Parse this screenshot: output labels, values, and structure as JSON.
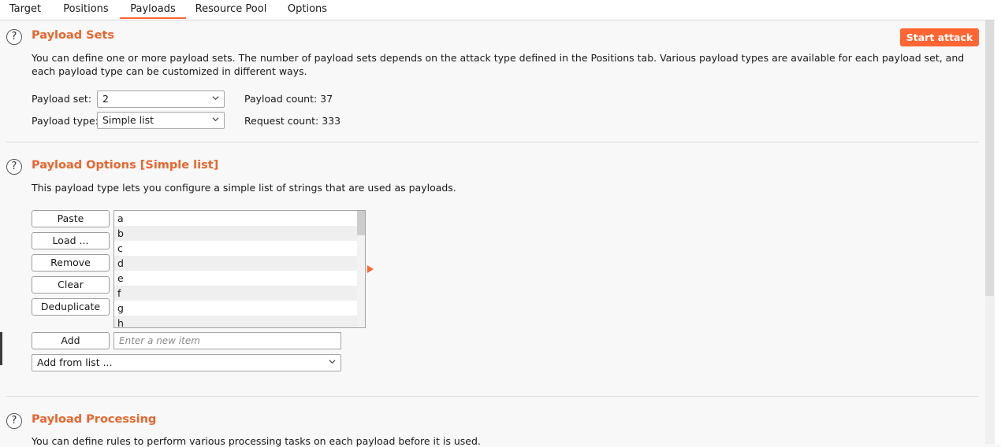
{
  "tabs": [
    {
      "label": "Target",
      "active": false
    },
    {
      "label": "Positions",
      "active": false
    },
    {
      "label": "Payloads",
      "active": true
    },
    {
      "label": "Resource Pool",
      "active": false
    },
    {
      "label": "Options",
      "active": false
    }
  ],
  "colors": {
    "accent": "#ff6633",
    "heading": "#e8662e"
  },
  "payload_sets": {
    "title": "Payload Sets",
    "start_attack": "Start attack",
    "description": "You can define one or more payload sets. The number of payload sets depends on the attack type defined in the Positions tab. Various payload types are available for each payload set, and each payload type can be customized in different ways.",
    "set_label": "Payload set:",
    "set_value": "2",
    "type_label": "Payload type:",
    "type_value": "Simple list",
    "payload_count": "Payload count: 37",
    "request_count": "Request count: 333"
  },
  "payload_options": {
    "title": "Payload Options [Simple list]",
    "description": "This payload type lets you configure a simple list of strings that are used as payloads.",
    "buttons": {
      "paste": "Paste",
      "load": "Load ...",
      "remove": "Remove",
      "clear": "Clear",
      "deduplicate": "Deduplicate",
      "add": "Add"
    },
    "items": [
      "a",
      "b",
      "c",
      "d",
      "e",
      "f",
      "g",
      "h"
    ],
    "new_item_placeholder": "Enter a new item",
    "add_from_list": "Add from list ..."
  },
  "payload_processing": {
    "title": "Payload Processing",
    "description": "You can define rules to perform various processing tasks on each payload before it is used."
  }
}
